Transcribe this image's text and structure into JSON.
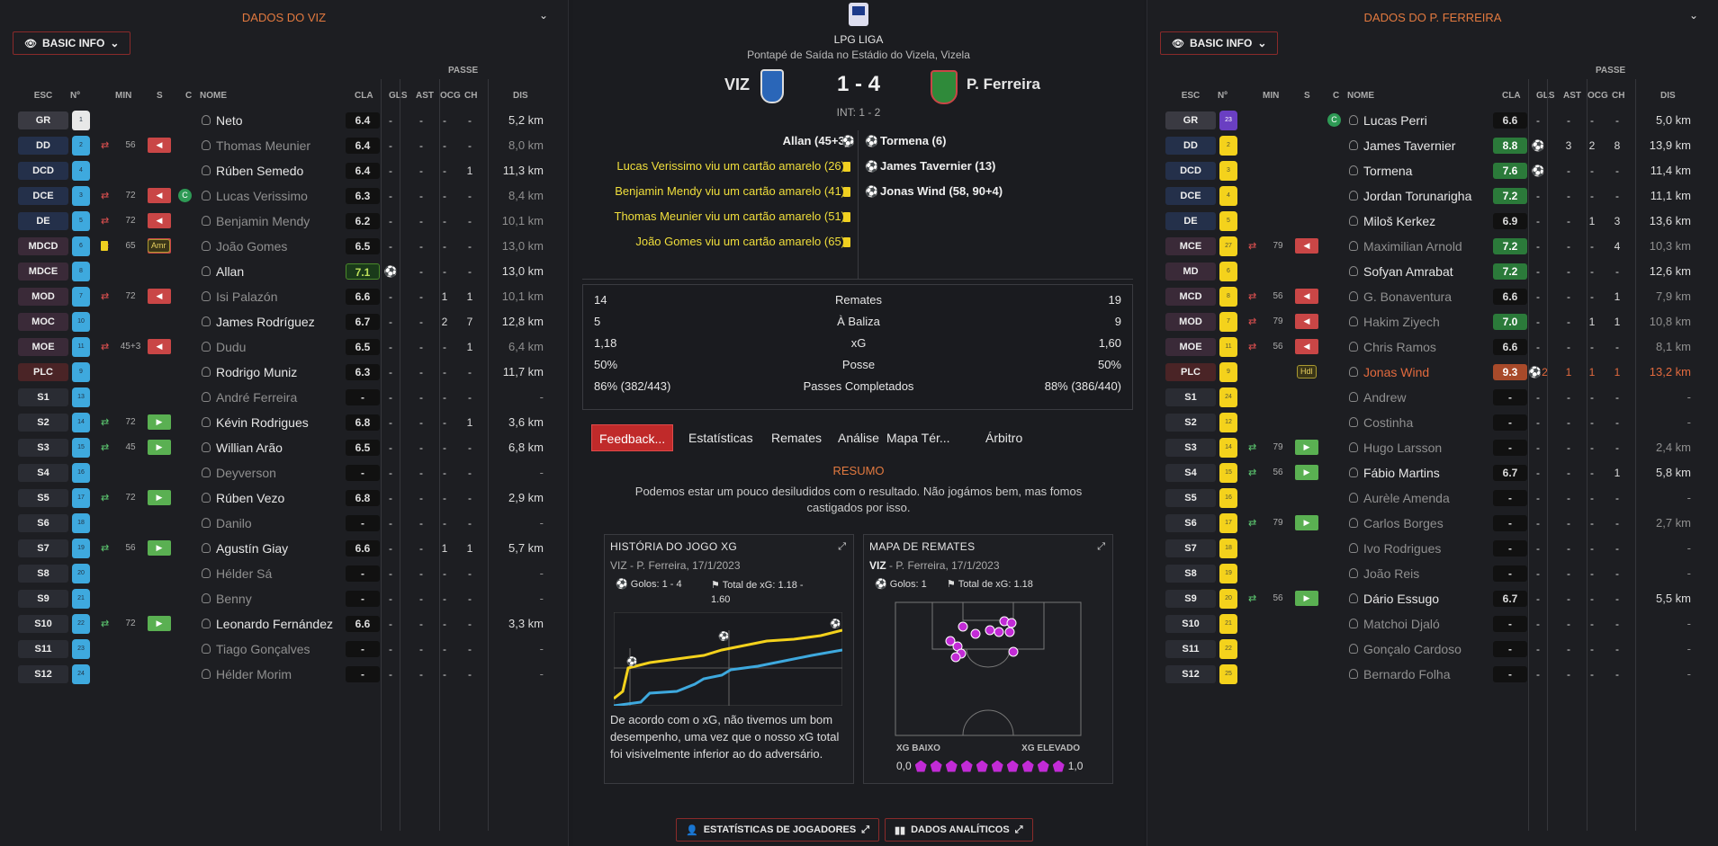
{
  "left": {
    "title": "DADOS DO VIZ",
    "basic_info": "BASIC INFO",
    "headers": {
      "passe": "PASSE",
      "esc": "ESC",
      "num": "Nº",
      "min": "MIN",
      "s": "S",
      "c": "C",
      "nome": "NOME",
      "cla": "CLA",
      "gls": "GLS",
      "ast": "AST",
      "ocg": "OCG",
      "ch": "CH",
      "dis": "DIS"
    },
    "players": [
      {
        "pos": "GR",
        "num": "1",
        "name": "Neto",
        "rating": "6.4",
        "gls": "-",
        "ast": "-",
        "ocg": "-",
        "ch": "-",
        "dis": "5,2 km"
      },
      {
        "pos": "DD",
        "num": "2",
        "min": "56",
        "name": "Thomas Meunier",
        "rating": "6.4",
        "gls": "-",
        "ast": "-",
        "ocg": "-",
        "ch": "-",
        "dis": "8,0 km"
      },
      {
        "pos": "DCD",
        "num": "4",
        "name": "Rúben Semedo",
        "rating": "6.4",
        "gls": "-",
        "ast": "-",
        "ocg": "-",
        "ch": "1",
        "dis": "11,3 km"
      },
      {
        "pos": "DCE",
        "num": "3",
        "min": "72",
        "name": "Lucas Verissimo",
        "rating": "6.3",
        "gls": "-",
        "ast": "-",
        "ocg": "-",
        "ch": "-",
        "dis": "8,4 km",
        "cap": "C"
      },
      {
        "pos": "DE",
        "num": "5",
        "min": "72",
        "name": "Benjamin Mendy",
        "rating": "6.2",
        "gls": "-",
        "ast": "-",
        "ocg": "-",
        "ch": "-",
        "dis": "10,1 km"
      },
      {
        "pos": "MDCD",
        "num": "6",
        "min": "65",
        "name": "João Gomes",
        "rating": "6.5",
        "gls": "-",
        "ast": "-",
        "ocg": "-",
        "ch": "-",
        "dis": "13,0 km",
        "badge": "Amr"
      },
      {
        "pos": "MDCE",
        "num": "8",
        "name": "Allan",
        "rating": "7.1",
        "gls": "⚽",
        "ast": "-",
        "ocg": "-",
        "ch": "-",
        "dis": "13,0 km"
      },
      {
        "pos": "MOD",
        "num": "7",
        "min": "72",
        "name": "Isi Palazón",
        "rating": "6.6",
        "gls": "-",
        "ast": "-",
        "ocg": "1",
        "ch": "1",
        "dis": "10,1 km"
      },
      {
        "pos": "MOC",
        "num": "10",
        "name": "James Rodríguez",
        "rating": "6.7",
        "gls": "-",
        "ast": "-",
        "ocg": "2",
        "ch": "7",
        "dis": "12,8 km"
      },
      {
        "pos": "MOE",
        "num": "11",
        "min": "45+3",
        "name": "Dudu",
        "rating": "6.5",
        "gls": "-",
        "ast": "-",
        "ocg": "-",
        "ch": "1",
        "dis": "6,4 km"
      },
      {
        "pos": "PLC",
        "num": "9",
        "name": "Rodrigo Muniz",
        "rating": "6.3",
        "gls": "-",
        "ast": "-",
        "ocg": "-",
        "ch": "-",
        "dis": "11,7 km"
      },
      {
        "pos": "S1",
        "num": "13",
        "name": "André Ferreira",
        "rating": "-",
        "gls": "-",
        "ast": "-",
        "ocg": "-",
        "ch": "-",
        "dis": "-"
      },
      {
        "pos": "S2",
        "num": "14",
        "min": "72",
        "name": "Kévin Rodrigues",
        "rating": "6.8",
        "gls": "-",
        "ast": "-",
        "ocg": "-",
        "ch": "1",
        "dis": "3,6 km"
      },
      {
        "pos": "S3",
        "num": "15",
        "min": "45",
        "name": "Willian Arão",
        "rating": "6.5",
        "gls": "-",
        "ast": "-",
        "ocg": "-",
        "ch": "-",
        "dis": "6,8 km"
      },
      {
        "pos": "S4",
        "num": "16",
        "name": "Deyverson",
        "rating": "-",
        "gls": "-",
        "ast": "-",
        "ocg": "-",
        "ch": "-",
        "dis": "-"
      },
      {
        "pos": "S5",
        "num": "17",
        "min": "72",
        "name": "Rúben Vezo",
        "rating": "6.8",
        "gls": "-",
        "ast": "-",
        "ocg": "-",
        "ch": "-",
        "dis": "2,9 km"
      },
      {
        "pos": "S6",
        "num": "18",
        "name": "Danilo",
        "rating": "-",
        "gls": "-",
        "ast": "-",
        "ocg": "-",
        "ch": "-",
        "dis": "-"
      },
      {
        "pos": "S7",
        "num": "19",
        "min": "56",
        "name": "Agustín Giay",
        "rating": "6.6",
        "gls": "-",
        "ast": "-",
        "ocg": "1",
        "ch": "1",
        "dis": "5,7 km"
      },
      {
        "pos": "S8",
        "num": "20",
        "name": "Hélder Sá",
        "rating": "-",
        "gls": "-",
        "ast": "-",
        "ocg": "-",
        "ch": "-",
        "dis": "-"
      },
      {
        "pos": "S9",
        "num": "21",
        "name": "Benny",
        "rating": "-",
        "gls": "-",
        "ast": "-",
        "ocg": "-",
        "ch": "-",
        "dis": "-"
      },
      {
        "pos": "S10",
        "num": "22",
        "min": "72",
        "name": "Leonardo Fernández",
        "rating": "6.6",
        "gls": "-",
        "ast": "-",
        "ocg": "-",
        "ch": "-",
        "dis": "3,3 km"
      },
      {
        "pos": "S11",
        "num": "23",
        "name": "Tiago Gonçalves",
        "rating": "-",
        "gls": "-",
        "ast": "-",
        "ocg": "-",
        "ch": "-",
        "dis": "-"
      },
      {
        "pos": "S12",
        "num": "24",
        "name": "Hélder Morim",
        "rating": "-",
        "gls": "-",
        "ast": "-",
        "ocg": "-",
        "ch": "-",
        "dis": "-"
      }
    ]
  },
  "right": {
    "title": "DADOS DO P. FERREIRA",
    "basic_info": "BASIC INFO",
    "headers": {
      "passe": "PASSE",
      "esc": "ESC",
      "num": "Nº",
      "min": "MIN",
      "s": "S",
      "c": "C",
      "nome": "NOME",
      "cla": "CLA",
      "gls": "GLS",
      "ast": "AST",
      "ocg": "OCG",
      "ch": "CH",
      "dis": "DIS"
    },
    "players": [
      {
        "pos": "GR",
        "num": "23",
        "name": "Lucas Perri",
        "rating": "6.6",
        "gls": "-",
        "ast": "-",
        "ocg": "-",
        "ch": "-",
        "dis": "5,0 km",
        "cap": "C"
      },
      {
        "pos": "DD",
        "num": "2",
        "name": "James Tavernier",
        "rating": "8.8",
        "gls": "⚽",
        "ast": "3",
        "ocg": "2",
        "ch": "8",
        "dis": "13,9 km"
      },
      {
        "pos": "DCD",
        "num": "3",
        "name": "Tormena",
        "rating": "7.6",
        "gls": "⚽",
        "ast": "-",
        "ocg": "-",
        "ch": "-",
        "dis": "11,4 km"
      },
      {
        "pos": "DCE",
        "num": "4",
        "name": "Jordan Torunarigha",
        "rating": "7.2",
        "gls": "-",
        "ast": "-",
        "ocg": "-",
        "ch": "-",
        "dis": "11,1 km"
      },
      {
        "pos": "DE",
        "num": "5",
        "name": "Miloš Kerkez",
        "rating": "6.9",
        "gls": "-",
        "ast": "-",
        "ocg": "1",
        "ch": "3",
        "dis": "13,6 km"
      },
      {
        "pos": "MCE",
        "num": "27",
        "min": "79",
        "name": "Maximilian Arnold",
        "rating": "7.2",
        "gls": "-",
        "ast": "-",
        "ocg": "-",
        "ch": "4",
        "dis": "10,3 km"
      },
      {
        "pos": "MD",
        "num": "6",
        "name": "Sofyan Amrabat",
        "rating": "7.2",
        "gls": "-",
        "ast": "-",
        "ocg": "-",
        "ch": "-",
        "dis": "12,6 km"
      },
      {
        "pos": "MCD",
        "num": "8",
        "min": "56",
        "name": "G. Bonaventura",
        "rating": "6.6",
        "gls": "-",
        "ast": "-",
        "ocg": "-",
        "ch": "1",
        "dis": "7,9 km"
      },
      {
        "pos": "MOD",
        "num": "7",
        "min": "79",
        "name": "Hakim Ziyech",
        "rating": "7.0",
        "gls": "-",
        "ast": "-",
        "ocg": "1",
        "ch": "1",
        "dis": "10,8 km"
      },
      {
        "pos": "MOE",
        "num": "11",
        "min": "56",
        "name": "Chris Ramos",
        "rating": "6.6",
        "gls": "-",
        "ast": "-",
        "ocg": "-",
        "ch": "-",
        "dis": "8,1 km"
      },
      {
        "pos": "PLC",
        "num": "9",
        "name": "Jonas Wind",
        "rating": "9.3",
        "gls": "⚽2",
        "ast": "1",
        "ocg": "1",
        "ch": "1",
        "dis": "13,2 km",
        "badge": "Hdl",
        "hl": true
      },
      {
        "pos": "S1",
        "num": "24",
        "name": "Andrew",
        "rating": "-",
        "gls": "-",
        "ast": "-",
        "ocg": "-",
        "ch": "-",
        "dis": "-"
      },
      {
        "pos": "S2",
        "num": "12",
        "name": "Costinha",
        "rating": "-",
        "gls": "-",
        "ast": "-",
        "ocg": "-",
        "ch": "-",
        "dis": "-"
      },
      {
        "pos": "S3",
        "num": "14",
        "min": "79",
        "name": "Hugo Larsson",
        "rating": "-",
        "gls": "-",
        "ast": "-",
        "ocg": "-",
        "ch": "-",
        "dis": "2,4 km"
      },
      {
        "pos": "S4",
        "num": "15",
        "min": "56",
        "name": "Fábio Martins",
        "rating": "6.7",
        "gls": "-",
        "ast": "-",
        "ocg": "-",
        "ch": "1",
        "dis": "5,8 km"
      },
      {
        "pos": "S5",
        "num": "16",
        "name": "Aurèle Amenda",
        "rating": "-",
        "gls": "-",
        "ast": "-",
        "ocg": "-",
        "ch": "-",
        "dis": "-"
      },
      {
        "pos": "S6",
        "num": "17",
        "min": "79",
        "name": "Carlos Borges",
        "rating": "-",
        "gls": "-",
        "ast": "-",
        "ocg": "-",
        "ch": "-",
        "dis": "2,7 km"
      },
      {
        "pos": "S7",
        "num": "18",
        "name": "Ivo Rodrigues",
        "rating": "-",
        "gls": "-",
        "ast": "-",
        "ocg": "-",
        "ch": "-",
        "dis": "-"
      },
      {
        "pos": "S8",
        "num": "19",
        "name": "João Reis",
        "rating": "-",
        "gls": "-",
        "ast": "-",
        "ocg": "-",
        "ch": "-",
        "dis": "-"
      },
      {
        "pos": "S9",
        "num": "20",
        "min": "56",
        "name": "Dário Essugo",
        "rating": "6.7",
        "gls": "-",
        "ast": "-",
        "ocg": "-",
        "ch": "-",
        "dis": "5,5 km"
      },
      {
        "pos": "S10",
        "num": "21",
        "name": "Matchoi Djaló",
        "rating": "-",
        "gls": "-",
        "ast": "-",
        "ocg": "-",
        "ch": "-",
        "dis": "-"
      },
      {
        "pos": "S11",
        "num": "22",
        "name": "Gonçalo Cardoso",
        "rating": "-",
        "gls": "-",
        "ast": "-",
        "ocg": "-",
        "ch": "-",
        "dis": "-"
      },
      {
        "pos": "S12",
        "num": "25",
        "name": "Bernardo Folha",
        "rating": "-",
        "gls": "-",
        "ast": "-",
        "ocg": "-",
        "ch": "-",
        "dis": "-"
      }
    ]
  },
  "center": {
    "competition": "LPG LIGA",
    "venue": "Pontapé de Saída no Estádio do Vizela, Vizela",
    "home": "VIZ",
    "away": "P. Ferreira",
    "score": "1 - 4",
    "halftime": "INT: 1 - 2",
    "home_events": [
      "Allan (45+3)"
    ],
    "home_cards": [
      "Lucas Verissimo viu um cartão amarelo (26)",
      "Benjamin Mendy viu um cartão amarelo (41)",
      "Thomas Meunier viu um cartão amarelo (51)",
      "João Gomes viu um cartão amarelo (65)"
    ],
    "away_events": [
      "Tormena (6)",
      "James Tavernier (13)",
      "Jonas Wind (58, 90+4)"
    ],
    "stats": [
      {
        "home": "14",
        "label": "Remates",
        "away": "19"
      },
      {
        "home": "5",
        "label": "À Baliza",
        "away": "9"
      },
      {
        "home": "1,18",
        "label": "xG",
        "away": "1,60"
      },
      {
        "home": "50%",
        "label": "Posse",
        "away": "50%"
      },
      {
        "home": "86% (382/443)",
        "label": "Passes Completados",
        "away": "88% (386/440)"
      }
    ],
    "tabs": [
      "Feedback...",
      "Estatísticas",
      "Remates",
      "Análise",
      "Mapa Tér...",
      "Árbitro"
    ],
    "resumo_title": "RESUMO",
    "resumo_text": "Podemos estar um pouco desiludidos com o resultado. Não jogámos bem, mas fomos castigados por isso.",
    "xg_card": {
      "title": "HISTÓRIA DO JOGO XG",
      "subtitle": "VIZ - P. Ferreira, 17/1/2023",
      "goals": "Golos: 1 - 4",
      "xg_total": "Total de xG: 1.18 - 1.60",
      "text": "De acordo com o xG, não tivemos um bom desempenho, uma vez que o nosso xG total foi visivelmente inferior ao do adversário."
    },
    "shot_card": {
      "title": "MAPA DE REMATES",
      "team": "VIZ",
      "subtitle": " - P. Ferreira, 17/1/2023",
      "goals": "Golos: 1",
      "xg_total": "Total de xG: 1.18",
      "low": "XG BAIXO",
      "high": "XG ELEVADO",
      "min": "0,0",
      "max": "1,0"
    },
    "btn_players": "ESTATÍSTICAS DE JOGADORES",
    "btn_analytics": "DADOS ANALÍTICOS"
  },
  "colors": {
    "accent": "#e2793f",
    "home_shirt": "#3ea9de",
    "away_shirt": "#f4d21c",
    "yellow_text": "#f1df3c"
  }
}
